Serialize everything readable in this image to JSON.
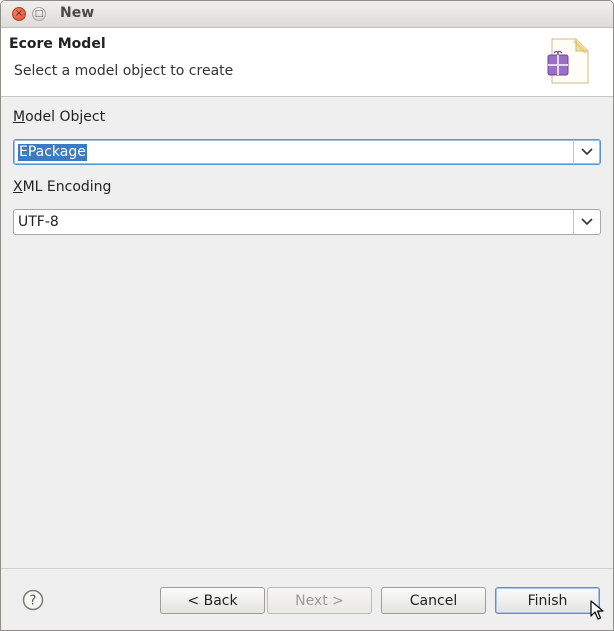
{
  "window": {
    "title": "New",
    "close_glyph": "×",
    "maximize_glyph": "□"
  },
  "header": {
    "title": "Ecore Model",
    "message": "Select a model object to create",
    "banner_icon": "ecore-model-icon"
  },
  "model_object": {
    "label_mnemonic": "M",
    "label_rest": "odel Object",
    "value": "EPackage"
  },
  "xml_encoding": {
    "label_mnemonic": "X",
    "label_rest": "ML Encoding",
    "value": "UTF-8"
  },
  "footer": {
    "help_icon": "help-icon",
    "back_label": "< Back",
    "next_label": "Next >",
    "cancel_label": "Cancel",
    "finish_label": "Finish"
  },
  "colors": {
    "selection": "#3d7bc1",
    "focus_border": "#5a93d1",
    "icon_purple": "#9b6fc6"
  }
}
